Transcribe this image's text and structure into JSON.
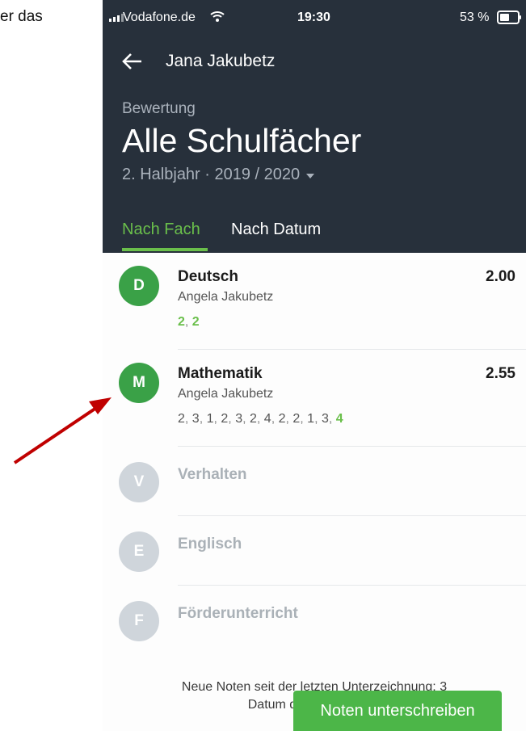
{
  "outside_text": "er das",
  "status_bar": {
    "carrier": "Vodafone.de",
    "time": "19:30",
    "battery_percent": "53 %",
    "battery_level": 0.53
  },
  "nav": {
    "title": "Jana Jakubetz",
    "back_icon": "arrow-left-icon"
  },
  "header": {
    "overline": "Bewertung",
    "title": "Alle Schulfächer",
    "period": "2. Halbjahr · 2019 / 2020"
  },
  "tabs": [
    {
      "label": "Nach Fach",
      "active": true
    },
    {
      "label": "Nach Datum",
      "active": false
    }
  ],
  "subjects": [
    {
      "initial": "D",
      "name": "Deutsch",
      "average": "2.00",
      "teacher": "Angela Jakubetz",
      "grades": [
        {
          "value": "2",
          "new": true
        },
        {
          "value": "2",
          "new": true
        }
      ]
    },
    {
      "initial": "M",
      "name": "Mathematik",
      "average": "2.55",
      "teacher": "Angela Jakubetz",
      "grades": [
        {
          "value": "2",
          "new": false
        },
        {
          "value": "3",
          "new": false
        },
        {
          "value": "1",
          "new": false
        },
        {
          "value": "2",
          "new": false
        },
        {
          "value": "3",
          "new": false
        },
        {
          "value": "2",
          "new": false
        },
        {
          "value": "4",
          "new": false
        },
        {
          "value": "2",
          "new": false
        },
        {
          "value": "2",
          "new": false
        },
        {
          "value": "1",
          "new": false
        },
        {
          "value": "3",
          "new": false
        },
        {
          "value": "4",
          "new": true
        }
      ]
    },
    {
      "initial": "V",
      "name": "Verhalten"
    },
    {
      "initial": "E",
      "name": "Englisch"
    },
    {
      "initial": "F",
      "name": "Förderunterricht"
    }
  ],
  "footer": {
    "line1": "Neue Noten seit der letzten Unterzeichnung: 3",
    "line2": "Datum der letzten Unte"
  },
  "sign_button": "Noten unterschreiben",
  "colors": {
    "header_bg": "#27303b",
    "accent_green": "#6abf4b",
    "avatar_green": "#3aa147",
    "button_green": "#4cb648",
    "arrow_red": "#c00000"
  }
}
